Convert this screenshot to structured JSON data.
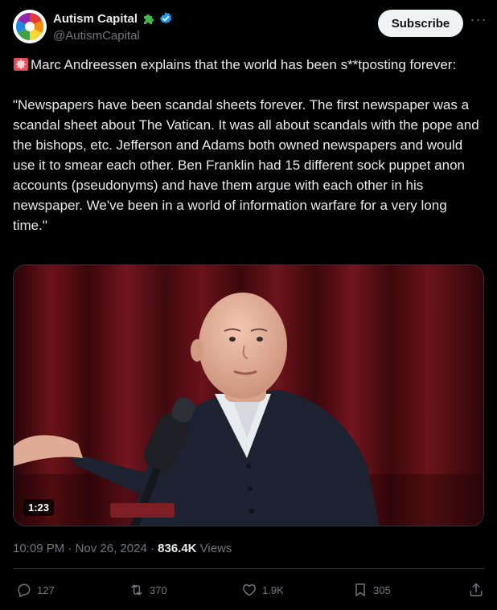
{
  "author": {
    "display_name": "Autism Capital",
    "handle": "@AutismCapital",
    "badge_icon": "puzzle-piece-icon",
    "verified_icon": "verified-badge-icon",
    "verified_color": "#1d9bf0",
    "badge_color": "#3fb950"
  },
  "header": {
    "subscribe_label": "Subscribe",
    "more_label": "···"
  },
  "tweet": {
    "lead_icon": "police-light-icon",
    "text": "Marc Andreessen explains that the world has been s**tposting forever:\n\n\"Newspapers have been scandal sheets forever. The first newspaper was a scandal sheet about The Vatican. It was all about scandals with the pope and the bishops, etc. Jefferson and Adams both owned newspapers and would use it to smear each other. Ben Franklin had 15 different sock puppet anon accounts (pseudonyms) and have them argue with each other in his newspaper. We've been in a world of information warfare for a very long time.\""
  },
  "media": {
    "type": "video",
    "duration": "1:23"
  },
  "meta": {
    "time": "10:09 PM",
    "separator": " · ",
    "date": "Nov 26, 2024",
    "views_count": "836.4K",
    "views_label": " Views"
  },
  "actions": {
    "replies": "127",
    "reposts": "370",
    "likes": "1.9K",
    "bookmarks": "305"
  },
  "colors": {
    "background": "#000000",
    "text_primary": "#e7e9ea",
    "text_secondary": "#71767b",
    "divider": "#2f3336",
    "subscribe_bg": "#eff3f4"
  }
}
